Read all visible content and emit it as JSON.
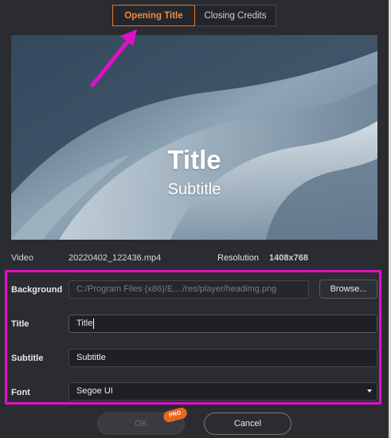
{
  "tabs": [
    {
      "label": "Opening Title",
      "active": true
    },
    {
      "label": "Closing Credits",
      "active": false
    }
  ],
  "preview": {
    "title": "Title",
    "subtitle": "Subtitle"
  },
  "info": {
    "video_label": "Video",
    "video_value": "20220402_122436.mp4",
    "resolution_label": "Resolution",
    "resolution_value": "1408x768"
  },
  "form": {
    "background_label": "Background",
    "background_path": "C:/Program Files (x86)/E..../res/player/headimg.png",
    "browse_label": "Browse...",
    "title_label": "Title",
    "title_value": "Title",
    "subtitle_label": "Subtitle",
    "subtitle_value": "Subtitle",
    "font_label": "Font",
    "font_value": "Segoe UI"
  },
  "buttons": {
    "ok_label": "OK",
    "cancel_label": "Cancel",
    "pro_badge": "PRO"
  },
  "colors": {
    "accent_orange": "#e07a2a",
    "highlight_magenta": "#e010c8",
    "background": "#2b2c31"
  }
}
